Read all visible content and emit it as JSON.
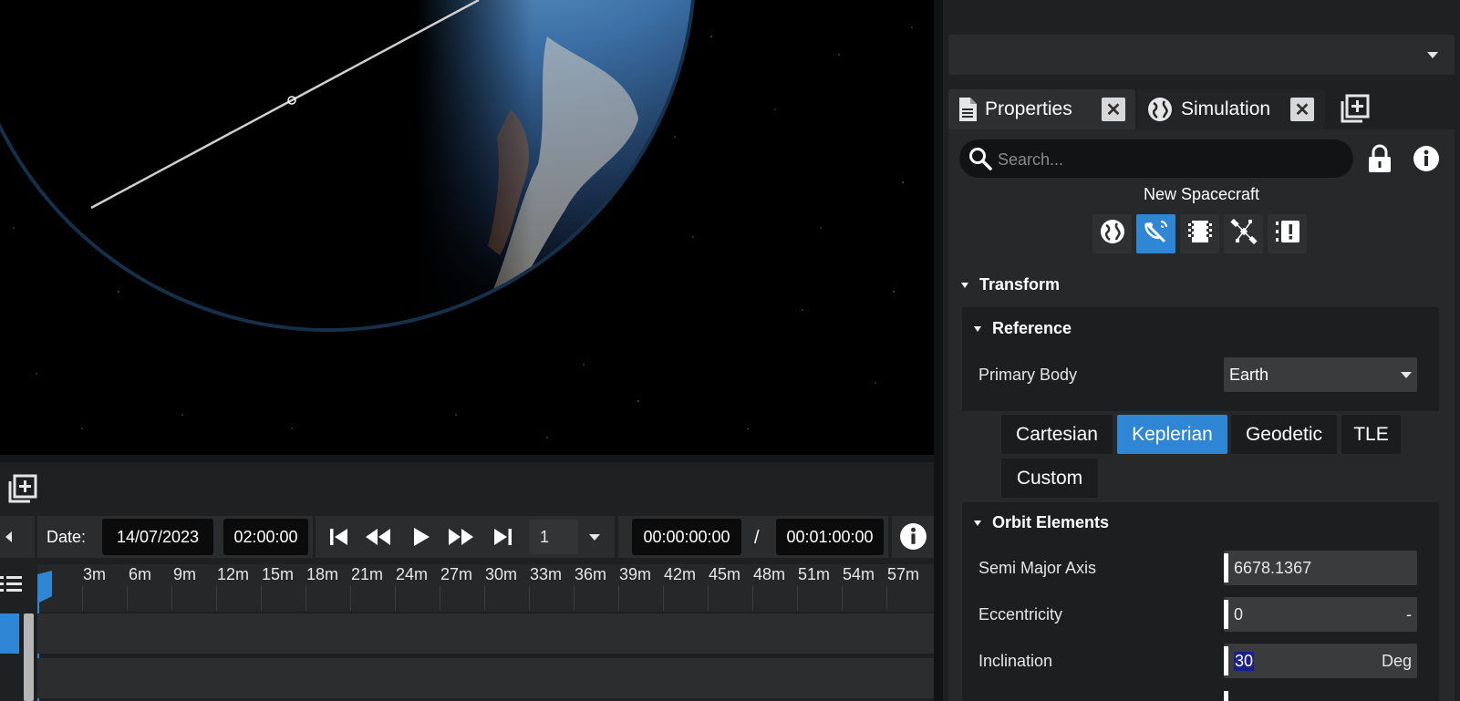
{
  "viewport": {
    "label": "3D viewport"
  },
  "right_panel": {
    "top_dropdown_value": "",
    "tabs": [
      {
        "label": "Properties",
        "icon": "document-icon"
      },
      {
        "label": "Simulation",
        "icon": "globe-icon"
      }
    ],
    "search_placeholder": "Search...",
    "object_name": "New Spacecraft",
    "component_icons": [
      "globe-icon",
      "satellite-dish-icon",
      "film-strip-icon",
      "satellite-icon",
      "alert-list-icon"
    ],
    "transform": {
      "title": "Transform",
      "reference": {
        "title": "Reference",
        "primary_body_label": "Primary Body",
        "primary_body_value": "Earth"
      },
      "coordinate_tabs": [
        "Cartesian",
        "Keplerian",
        "Geodetic",
        "TLE",
        "Custom"
      ],
      "active_coordinate_tab": "Keplerian",
      "orbit_elements": {
        "title": "Orbit Elements",
        "fields": [
          {
            "label": "Semi Major Axis",
            "value": "6678.1367",
            "unit": ""
          },
          {
            "label": "Eccentricity",
            "value": "0",
            "unit": "-"
          },
          {
            "label": "Inclination",
            "value": "30",
            "unit": "Deg"
          }
        ]
      }
    }
  },
  "timeline": {
    "date_label": "Date:",
    "date_value": "14/07/2023",
    "time_value": "02:00:00",
    "speed_value": "1",
    "current_time": "00:00:00:00",
    "separator": "/",
    "total_time": "00:01:00:00",
    "ticks": [
      "3m",
      "6m",
      "9m",
      "12m",
      "15m",
      "18m",
      "21m",
      "24m",
      "27m",
      "30m",
      "33m",
      "36m",
      "39m",
      "42m",
      "45m",
      "48m",
      "51m",
      "54m",
      "57m"
    ]
  },
  "colors": {
    "accent": "#2e86d4",
    "panel_bg": "#1f2022",
    "earth_blue": "#3e86c8"
  }
}
